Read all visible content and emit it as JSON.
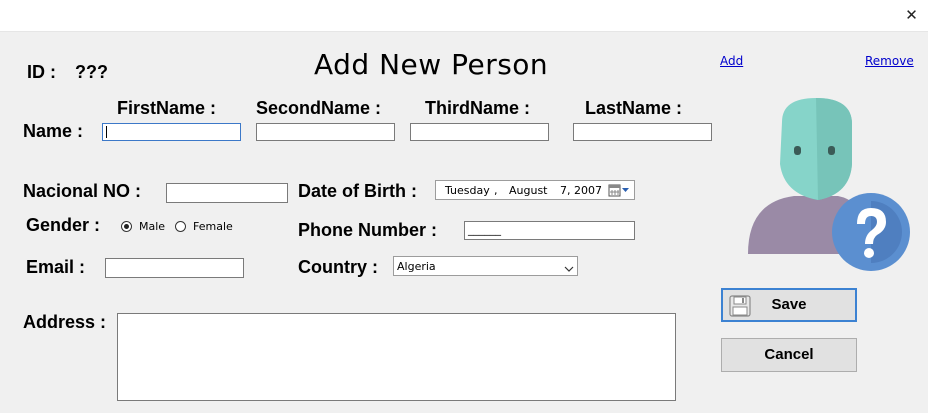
{
  "window": {
    "close_glyph": "✕"
  },
  "form": {
    "title": "Add New Person",
    "id_label": "ID :",
    "id_value": "???",
    "add_link": "Add",
    "remove_link": "Remove"
  },
  "name": {
    "label": "Name :",
    "first_label": "FirstName :",
    "second_label": "SecondName :",
    "third_label": "ThirdName :",
    "last_label": "LastName :",
    "first_value": "",
    "second_value": "",
    "third_value": "",
    "last_value": ""
  },
  "national_no": {
    "label": "Nacional NO :",
    "value": ""
  },
  "date_of_birth": {
    "label": "Date of Birth :",
    "weekday": "Tuesday",
    "sep": ",",
    "month": "August",
    "day_year": "7, 2007",
    "icon": "calendar-icon"
  },
  "gender": {
    "label": "Gender :",
    "options": [
      "Male",
      "Female"
    ],
    "selected": "Male"
  },
  "phone": {
    "label": "Phone Number :",
    "value": "______"
  },
  "email": {
    "label": "Email :",
    "value": ""
  },
  "country": {
    "label": "Country :",
    "selected": "Algeria"
  },
  "address": {
    "label": "Address :",
    "value": ""
  },
  "buttons": {
    "save": "Save",
    "cancel": "Cancel"
  },
  "colors": {
    "accent": "#3c82d2",
    "avatar_face": "#86d4c9",
    "avatar_body": "#9a8aa6",
    "question_badge": "#5b8fd0"
  }
}
